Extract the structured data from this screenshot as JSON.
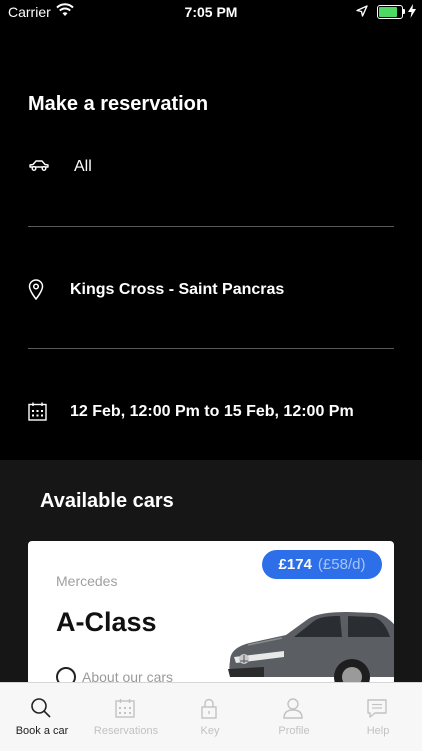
{
  "status_bar": {
    "carrier": "Carrier",
    "time": "7:05 PM",
    "battery_level": 0.9
  },
  "reservation": {
    "title": "Make a reservation",
    "vehicle_type": {
      "icon": "car-icon",
      "value": "All"
    },
    "location": {
      "icon": "location-pin-icon",
      "value": "Kings Cross - Saint Pancras"
    },
    "dates": {
      "icon": "calendar-icon",
      "value": "12 Feb, 12:00 Pm to 15 Feb, 12:00 Pm"
    }
  },
  "available": {
    "title": "Available cars",
    "cars": [
      {
        "brand": "Mercedes",
        "model": "A-Class",
        "price": "£174",
        "price_per_day": "(£58/d)",
        "about_label": "About our cars"
      }
    ]
  },
  "tabs": [
    {
      "label": "Book a car",
      "icon": "search-icon",
      "active": true
    },
    {
      "label": "Reservations",
      "icon": "calendar-icon",
      "active": false
    },
    {
      "label": "Key",
      "icon": "lock-icon",
      "active": false
    },
    {
      "label": "Profile",
      "icon": "person-icon",
      "active": false
    },
    {
      "label": "Help",
      "icon": "chat-icon",
      "active": false
    }
  ],
  "colors": {
    "accent": "#2c6fe8",
    "background": "#000000",
    "card": "#ffffff",
    "battery": "#4cd964"
  }
}
